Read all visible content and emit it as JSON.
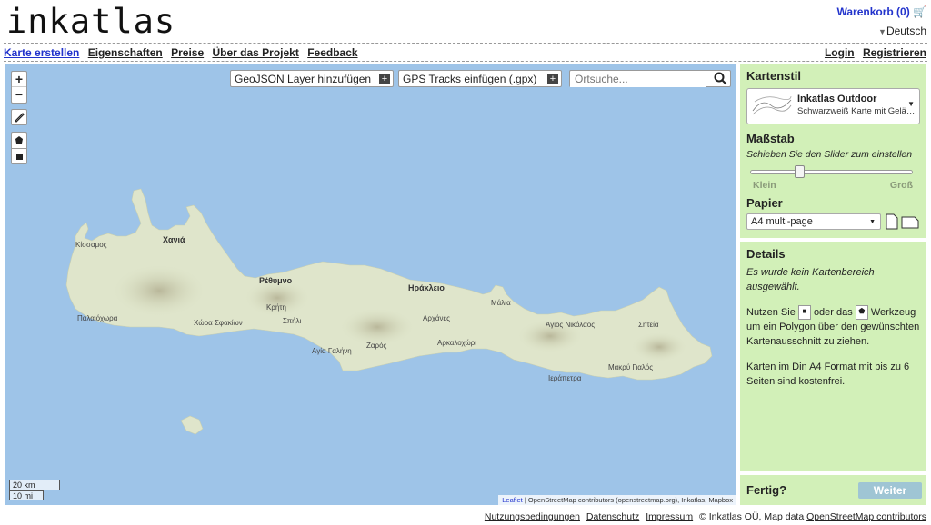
{
  "brand": {
    "logo": "inkatlas"
  },
  "header": {
    "cart_label": "Warenkorb (0) 🛒",
    "language": "Deutsch"
  },
  "nav": {
    "left": [
      "Karte erstellen",
      "Eigenschaften",
      "Preise",
      "Über das Projekt",
      "Feedback"
    ],
    "right": [
      "Login",
      "Registrieren"
    ]
  },
  "map": {
    "zoom_in": "+",
    "zoom_out": "−",
    "geojson_button": "GeoJSON Layer hinzufügen",
    "gpx_button": "GPS Tracks einfügen (.gpx)",
    "search_placeholder": "Ortsuche...",
    "scale_km": "20 km",
    "scale_mi": "10 mi",
    "attribution_leaflet": "Leaflet",
    "attribution_rest": " | OpenStreetMap contributors (openstreetmap.org), Inkatlas, Mapbox",
    "places": {
      "chania": "Χανιά",
      "kissamos": "Κίσσαμος",
      "rethymno": "Ρέθυμνο",
      "heraklion": "Ηράκλειο",
      "malia": "Μάλια",
      "palaiochora": "Παλαιόχωρα",
      "chora_sfakion": "Χώρα Σφακίων",
      "spili": "Σπήλι",
      "kriti": "Κρήτη",
      "archanes": "Αρχάνες",
      "agios_nikolaos": "Άγιος Νικόλαος",
      "sitia": "Σητεία",
      "arkalochori": "Αρκαλοχώρι",
      "agia_galini": "Αγία Γαλήνη",
      "zaros": "Ζαρός",
      "ierapetra": "Ιεράπετρα",
      "makry_gialos": "Μακρύ Γιαλός"
    }
  },
  "sidebar": {
    "style_title": "Kartenstil",
    "style_name": "Inkatlas Outdoor",
    "style_desc": "Schwarzweiß Karte mit Gelä…",
    "scale_title": "Maßstab",
    "scale_hint": "Schieben Sie den Slider zum einstellen",
    "scale_min": "Klein",
    "scale_max": "Groß",
    "scale_level": 0.3,
    "paper_title": "Papier",
    "paper_value": "A4 multi-page",
    "details_title": "Details",
    "details_none": "Es wurde kein Kartenbereich ausgewählt.",
    "details_use_1": "Nutzen Sie",
    "details_use_2": "oder das",
    "details_use_3": "Werkzeug um ein Polygon über den gewünschten Kartenausschnitt zu ziehen.",
    "details_free": "Karten im Din A4 Format mit bis zu 6 Seiten sind kostenfrei.",
    "done_title": "Fertig?",
    "next_button": "Weiter"
  },
  "footer": {
    "terms": "Nutzungsbedingungen",
    "privacy": "Datenschutz",
    "imprint": "Impressum",
    "copyright_prefix": "© Inkatlas OÜ, Map data ",
    "osm": "OpenStreetMap contributors"
  },
  "colors": {
    "sea": "#9ec4e8",
    "land": "#dde3c9",
    "panel": "#d2f0b8",
    "link": "#2233cc",
    "next_button": "#9fc5d4"
  }
}
